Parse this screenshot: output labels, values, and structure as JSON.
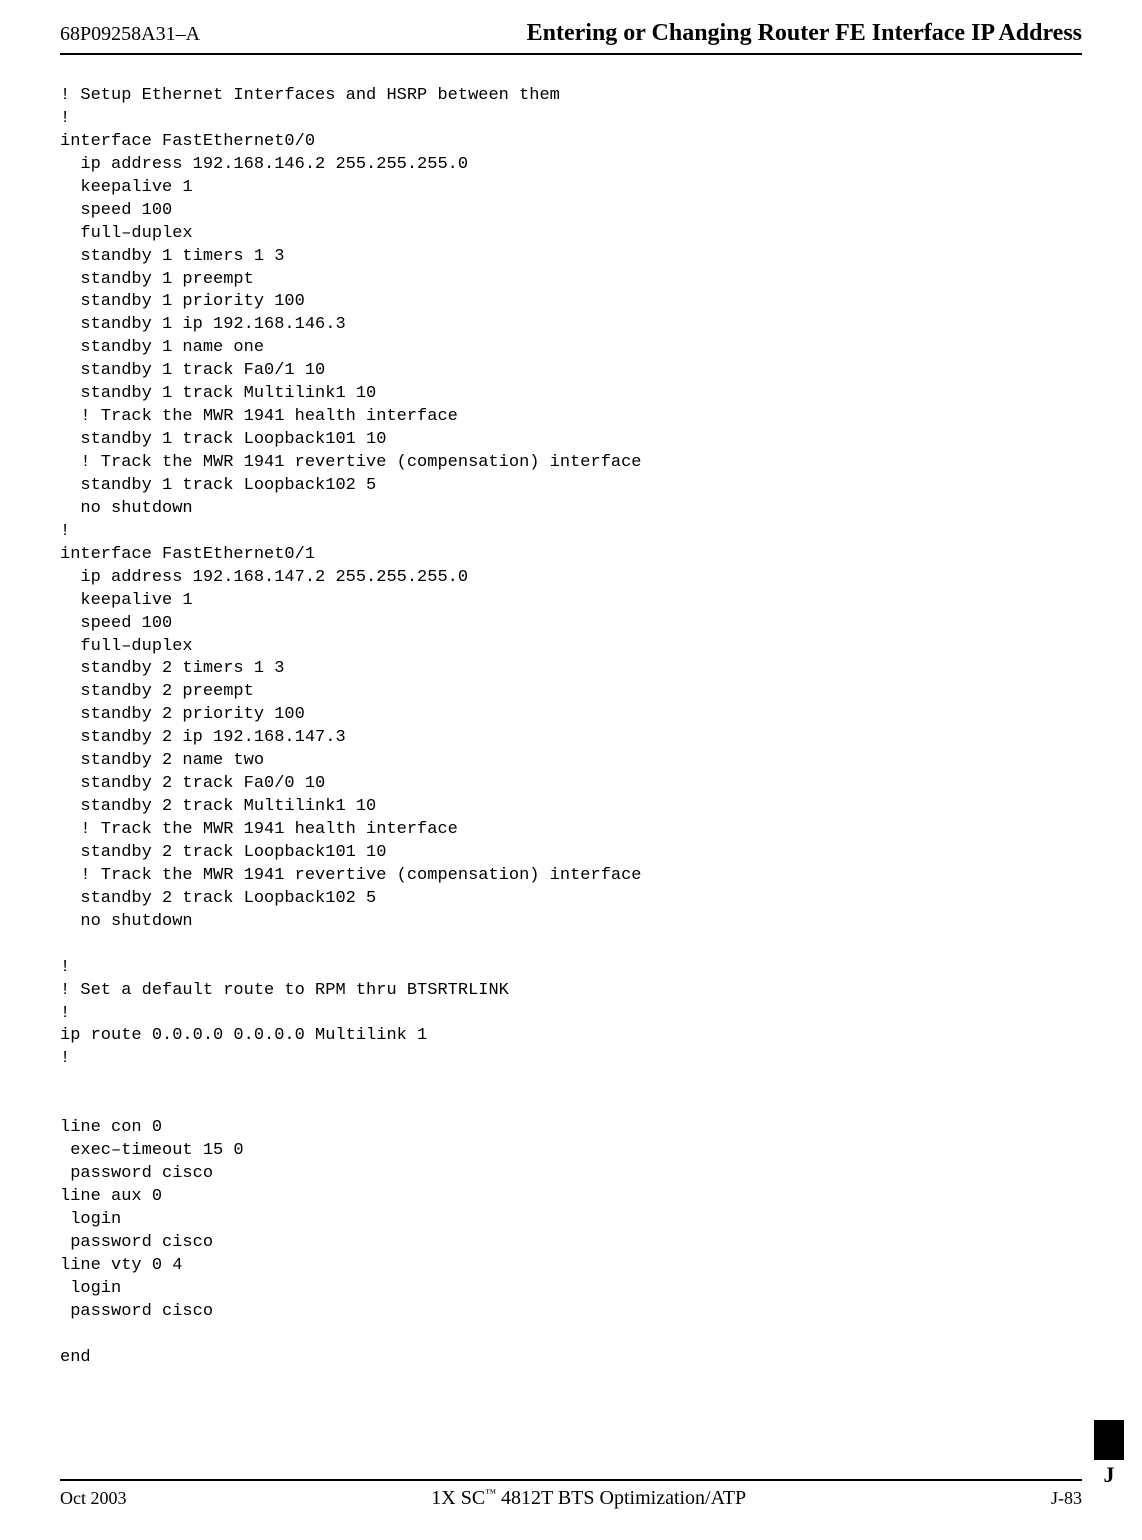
{
  "header": {
    "doc_id": "68P09258A31–A",
    "title": "Entering or Changing Router FE Interface IP Address"
  },
  "code": [
    "! Setup Ethernet Interfaces and HSRP between them",
    "!",
    "interface FastEthernet0/0",
    "  ip address 192.168.146.2 255.255.255.0",
    "  keepalive 1",
    "  speed 100",
    "  full–duplex",
    "  standby 1 timers 1 3",
    "  standby 1 preempt",
    "  standby 1 priority 100",
    "  standby 1 ip 192.168.146.3",
    "  standby 1 name one",
    "  standby 1 track Fa0/1 10",
    "  standby 1 track Multilink1 10",
    "  ! Track the MWR 1941 health interface",
    "  standby 1 track Loopback101 10",
    "  ! Track the MWR 1941 revertive (compensation) interface",
    "  standby 1 track Loopback102 5",
    "  no shutdown",
    "!",
    "interface FastEthernet0/1",
    "  ip address 192.168.147.2 255.255.255.0",
    "  keepalive 1",
    "  speed 100",
    "  full–duplex",
    "  standby 2 timers 1 3",
    "  standby 2 preempt",
    "  standby 2 priority 100",
    "  standby 2 ip 192.168.147.3",
    "  standby 2 name two",
    "  standby 2 track Fa0/0 10",
    "  standby 2 track Multilink1 10",
    "  ! Track the MWR 1941 health interface",
    "  standby 2 track Loopback101 10",
    "  ! Track the MWR 1941 revertive (compensation) interface",
    "  standby 2 track Loopback102 5",
    "  no shutdown",
    "",
    "!",
    "! Set a default route to RPM thru BTSRTRLINK",
    "!",
    "ip route 0.0.0.0 0.0.0.0 Multilink 1",
    "!",
    "",
    "",
    "line con 0",
    " exec–timeout 15 0",
    " password cisco",
    "line aux 0",
    " login",
    " password cisco",
    "line vty 0 4",
    " login",
    " password cisco",
    "",
    "end"
  ],
  "footer": {
    "date": "Oct 2003",
    "center_prefix": "1X SC",
    "center_suffix": " 4812T BTS Optimization/ATP",
    "page": "J-83",
    "tab": "J"
  }
}
